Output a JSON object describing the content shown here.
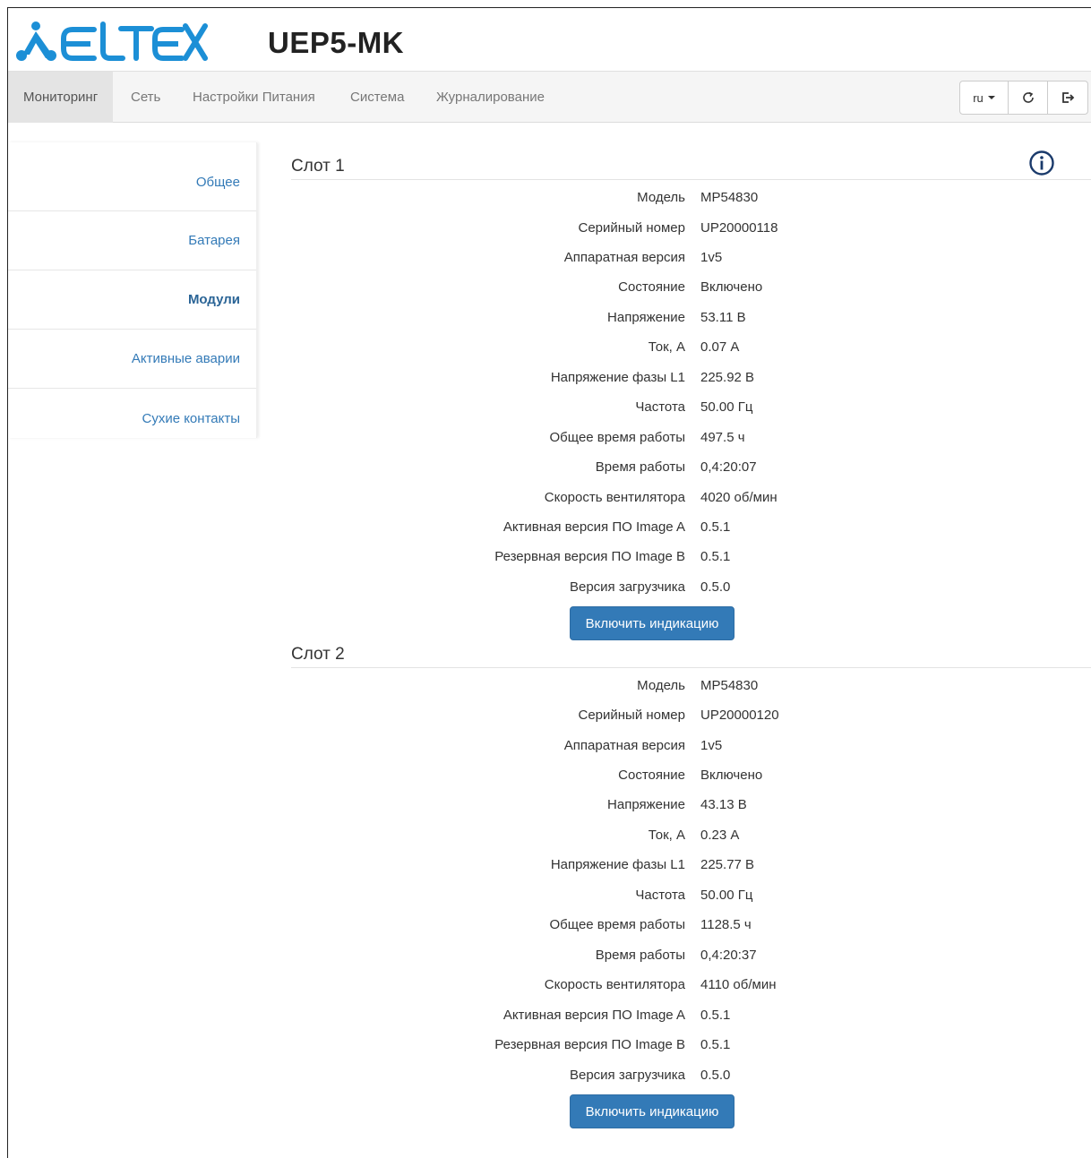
{
  "colors": {
    "logo_blue": "#1c8fd6",
    "link": "#337ab7",
    "primary_button": "#337ab7",
    "nav_background": "#f5f5f5",
    "nav_active": "#e4e4e4"
  },
  "header": {
    "logo_text": "ELTEX",
    "device_name": "UEP5-MK"
  },
  "navbar": {
    "items": [
      {
        "label": "Мониторинг",
        "active": true
      },
      {
        "label": "Сеть",
        "active": false
      },
      {
        "label": "Настройки Питания",
        "active": false
      },
      {
        "label": "Система",
        "active": false
      },
      {
        "label": "Журналирование",
        "active": false
      }
    ],
    "language": "ru",
    "refresh_icon": "refresh-icon",
    "logout_icon": "logout-icon"
  },
  "sidebar": {
    "items": [
      {
        "label": "Общее",
        "active": false
      },
      {
        "label": "Батарея",
        "active": false
      },
      {
        "label": "Модули",
        "active": true
      },
      {
        "label": "Активные аварии",
        "active": false
      },
      {
        "label": "Сухие контакты",
        "active": false
      }
    ]
  },
  "info_icon": "info-circle-icon",
  "slots": [
    {
      "title": "Слот 1",
      "rows": [
        {
          "label": "Модель",
          "value": "MP54830"
        },
        {
          "label": "Серийный номер",
          "value": "UP20000118"
        },
        {
          "label": "Аппаратная версия",
          "value": "1v5"
        },
        {
          "label": "Состояние",
          "value": "Включено"
        },
        {
          "label": "Напряжение",
          "value": "53.11 В"
        },
        {
          "label": "Ток, А",
          "value": "0.07 А"
        },
        {
          "label": "Напряжение фазы L1",
          "value": "225.92 В"
        },
        {
          "label": "Частота",
          "value": "50.00 Гц"
        },
        {
          "label": "Общее время работы",
          "value": "497.5 ч"
        },
        {
          "label": "Время работы",
          "value": "0,4:20:07"
        },
        {
          "label": "Скорость вентилятора",
          "value": "4020 об/мин"
        },
        {
          "label": "Активная версия ПО Image A",
          "value": "0.5.1"
        },
        {
          "label": "Резервная версия ПО Image B",
          "value": "0.5.1"
        },
        {
          "label": "Версия загрузчика",
          "value": "0.5.0"
        }
      ],
      "button_label": "Включить индикацию"
    },
    {
      "title": "Слот 2",
      "rows": [
        {
          "label": "Модель",
          "value": "MP54830"
        },
        {
          "label": "Серийный номер",
          "value": "UP20000120"
        },
        {
          "label": "Аппаратная версия",
          "value": "1v5"
        },
        {
          "label": "Состояние",
          "value": "Включено"
        },
        {
          "label": "Напряжение",
          "value": "43.13 В"
        },
        {
          "label": "Ток, А",
          "value": "0.23 А"
        },
        {
          "label": "Напряжение фазы L1",
          "value": "225.77 В"
        },
        {
          "label": "Частота",
          "value": "50.00 Гц"
        },
        {
          "label": "Общее время работы",
          "value": "1128.5 ч"
        },
        {
          "label": "Время работы",
          "value": "0,4:20:37"
        },
        {
          "label": "Скорость вентилятора",
          "value": "4110 об/мин"
        },
        {
          "label": "Активная версия ПО Image A",
          "value": "0.5.1"
        },
        {
          "label": "Резервная версия ПО Image B",
          "value": "0.5.1"
        },
        {
          "label": "Версия загрузчика",
          "value": "0.5.0"
        }
      ],
      "button_label": "Включить индикацию"
    }
  ]
}
